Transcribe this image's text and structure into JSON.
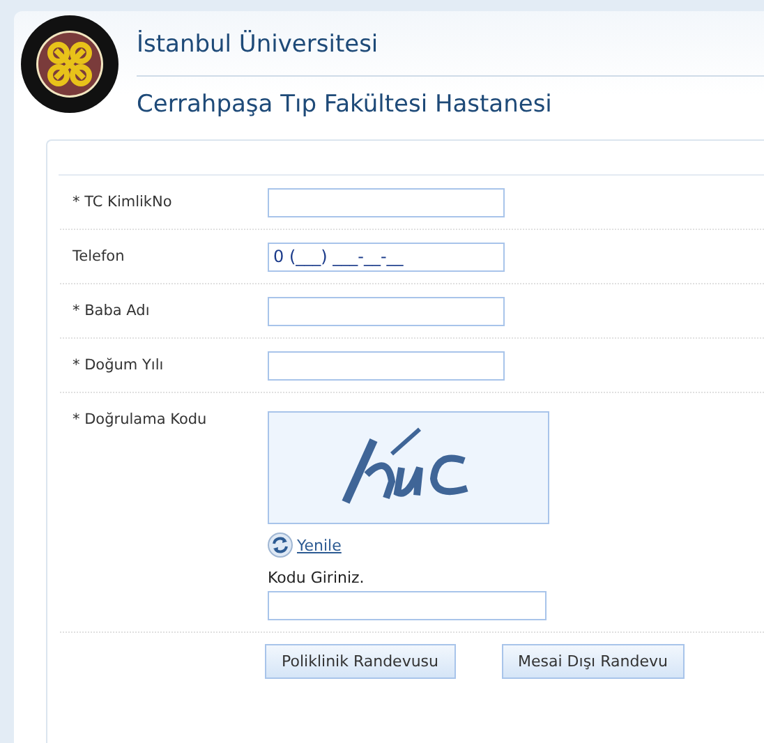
{
  "header": {
    "university": "İstanbul Üniversitesi",
    "hospital": "Cerrahpaşa Tıp Fakültesi Hastanesi"
  },
  "fields": [
    {
      "label": "* TC KimlikNo"
    },
    {
      "label": "Telefon",
      "value": "0 (___) ___-__-__"
    },
    {
      "label": "* Baba Adı"
    },
    {
      "label": "* Doğum Yılı"
    }
  ],
  "captcha": {
    "label": "* Doğrulama Kodu",
    "refresh": "Yenile",
    "prompt": "Kodu Giriniz."
  },
  "buttons": [
    "Poliklinik Randevusu",
    "Mesai Dışı Randevu"
  ]
}
